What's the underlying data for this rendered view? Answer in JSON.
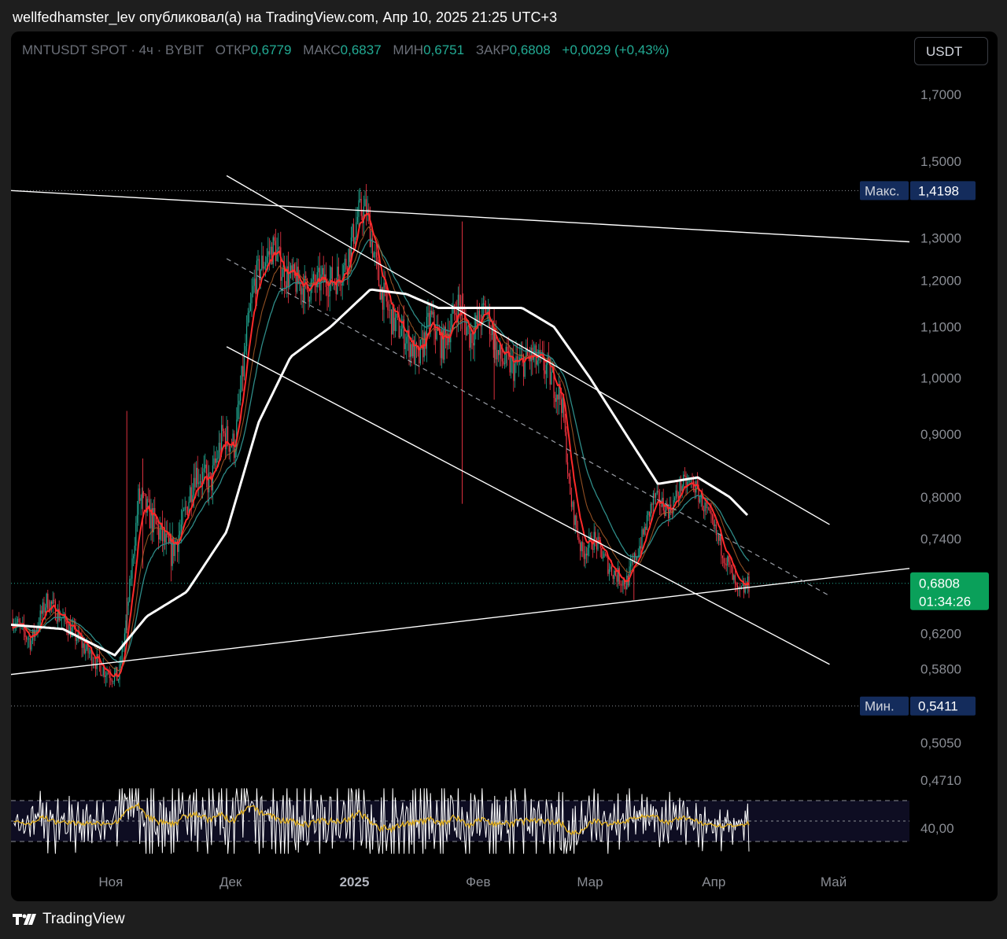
{
  "header": {
    "published_text": "wellfedhamster_lev опубликовал(а) на TradingView.com, Апр 10, 2025 21:25 UTC+3"
  },
  "legend": {
    "symbol": "MNTUSDT SPOT · 4ч · BYBIT",
    "open_label": "ОТКР",
    "open_value": "0,6779",
    "high_label": "МАКС",
    "high_value": "0,6837",
    "low_label": "МИН",
    "low_value": "0,6751",
    "close_label": "ЗАКР",
    "close_value": "0,6808",
    "change": "+0,0029 (+0,43%)"
  },
  "currency_button": "USDT",
  "footer": {
    "brand": "TradingView",
    "logo_icon": "tradingview-logo-icon"
  },
  "colors": {
    "background": "#000000",
    "up": "#22ab94",
    "down": "#f23645",
    "ema_fast": "#ff2a2a",
    "ema_slow": "#2e8b87",
    "sma": "#ffffff",
    "rsi": "#ffffff",
    "rsi_signal": "#e6b422",
    "badge_blue": "#142c5c",
    "price_badge": "#0aa05a"
  },
  "chart_data": {
    "type": "candlestick",
    "symbol": "MNTUSDT",
    "timeframe": "4ч",
    "y_scale": "log",
    "ylim": [
      0.44,
      1.8
    ],
    "y_ticks": [
      "1,7000",
      "1,5000",
      "1,3000",
      "1,2000",
      "1,1000",
      "1,0000",
      "0,9000",
      "0,8000",
      "0,7400",
      "0,6200",
      "0,5800",
      "0,5050",
      "0,4710"
    ],
    "x_ticks": [
      "Ноя",
      "Дек",
      "2025",
      "Фев",
      "Мар",
      "Апр",
      "Май"
    ],
    "max_marker": {
      "label": "Макс.",
      "value": "1,4198"
    },
    "min_marker": {
      "label": "Мин.",
      "value": "0,5411"
    },
    "last_price": {
      "value": "0,6808",
      "countdown": "01:34:26"
    },
    "price_path": [
      [
        "2024-10-07",
        0.64
      ],
      [
        "2024-10-12",
        0.61
      ],
      [
        "2024-10-16",
        0.66
      ],
      [
        "2024-10-21",
        0.63
      ],
      [
        "2024-10-26",
        0.6
      ],
      [
        "2024-10-30",
        0.58
      ],
      [
        "2024-11-03",
        0.57
      ],
      [
        "2024-11-05",
        0.64
      ],
      [
        "2024-11-08",
        0.8
      ],
      [
        "2024-11-12",
        0.76
      ],
      [
        "2024-11-16",
        0.72
      ],
      [
        "2024-11-19",
        0.76
      ],
      [
        "2024-11-22",
        0.84
      ],
      [
        "2024-11-26",
        0.82
      ],
      [
        "2024-11-29",
        0.9
      ],
      [
        "2024-12-02",
        0.88
      ],
      [
        "2024-12-05",
        1.08
      ],
      [
        "2024-12-07",
        1.2
      ],
      [
        "2024-12-09",
        1.24
      ],
      [
        "2024-12-12",
        1.28
      ],
      [
        "2024-12-14",
        1.22
      ],
      [
        "2024-12-17",
        1.2
      ],
      [
        "2024-12-20",
        1.18
      ],
      [
        "2024-12-24",
        1.2
      ],
      [
        "2024-12-27",
        1.2
      ],
      [
        "2024-12-30",
        1.24
      ],
      [
        "2025-01-02",
        1.36
      ],
      [
        "2025-01-04",
        1.37
      ],
      [
        "2025-01-07",
        1.2
      ],
      [
        "2025-01-10",
        1.12
      ],
      [
        "2025-01-14",
        1.08
      ],
      [
        "2025-01-17",
        1.03
      ],
      [
        "2025-01-20",
        1.12
      ],
      [
        "2025-01-23",
        1.06
      ],
      [
        "2025-01-27",
        1.15
      ],
      [
        "2025-01-30",
        1.08
      ],
      [
        "2025-02-03",
        1.14
      ],
      [
        "2025-02-06",
        1.04
      ],
      [
        "2025-02-10",
        1.02
      ],
      [
        "2025-02-14",
        1.04
      ],
      [
        "2025-02-18",
        1.02
      ],
      [
        "2025-02-22",
        0.96
      ],
      [
        "2025-02-24",
        0.8
      ],
      [
        "2025-02-27",
        0.72
      ],
      [
        "2025-03-02",
        0.74
      ],
      [
        "2025-03-06",
        0.7
      ],
      [
        "2025-03-10",
        0.68
      ],
      [
        "2025-03-14",
        0.74
      ],
      [
        "2025-03-17",
        0.8
      ],
      [
        "2025-03-21",
        0.78
      ],
      [
        "2025-03-24",
        0.82
      ],
      [
        "2025-03-27",
        0.82
      ],
      [
        "2025-03-30",
        0.78
      ],
      [
        "2025-04-02",
        0.74
      ],
      [
        "2025-04-05",
        0.7
      ],
      [
        "2025-04-07",
        0.665
      ],
      [
        "2025-04-10",
        0.6808
      ]
    ],
    "sma_path": [
      [
        "2024-10-07",
        0.63
      ],
      [
        "2024-10-20",
        0.625
      ],
      [
        "2024-11-02",
        0.595
      ],
      [
        "2024-11-10",
        0.64
      ],
      [
        "2024-11-20",
        0.67
      ],
      [
        "2024-11-30",
        0.75
      ],
      [
        "2024-12-08",
        0.92
      ],
      [
        "2024-12-16",
        1.04
      ],
      [
        "2024-12-26",
        1.1
      ],
      [
        "2025-01-05",
        1.18
      ],
      [
        "2025-01-14",
        1.17
      ],
      [
        "2025-01-22",
        1.14
      ],
      [
        "2025-02-01",
        1.14
      ],
      [
        "2025-02-12",
        1.14
      ],
      [
        "2025-02-20",
        1.1
      ],
      [
        "2025-03-01",
        1.0
      ],
      [
        "2025-03-10",
        0.9
      ],
      [
        "2025-03-18",
        0.82
      ],
      [
        "2025-03-28",
        0.83
      ],
      [
        "2025-04-05",
        0.8
      ],
      [
        "2025-04-10",
        0.77
      ]
    ],
    "trendlines": [
      {
        "name": "resistance-long",
        "p1": [
          "2024-10-07",
          1.42
        ],
        "p2": [
          "2025-05-20",
          1.29
        ]
      },
      {
        "name": "support-long",
        "p1": [
          "2024-10-07",
          0.574
        ],
        "p2": [
          "2025-05-20",
          0.7
        ]
      },
      {
        "name": "channel-top",
        "p1": [
          "2024-11-30",
          1.46
        ],
        "p2": [
          "2025-04-30",
          0.76
        ]
      },
      {
        "name": "channel-bottom",
        "p1": [
          "2024-11-30",
          1.06
        ],
        "p2": [
          "2025-04-30",
          0.585
        ]
      }
    ],
    "rsi": {
      "label": "40,00",
      "band_upper": 70,
      "band_lower": 30,
      "mid": 50
    }
  }
}
